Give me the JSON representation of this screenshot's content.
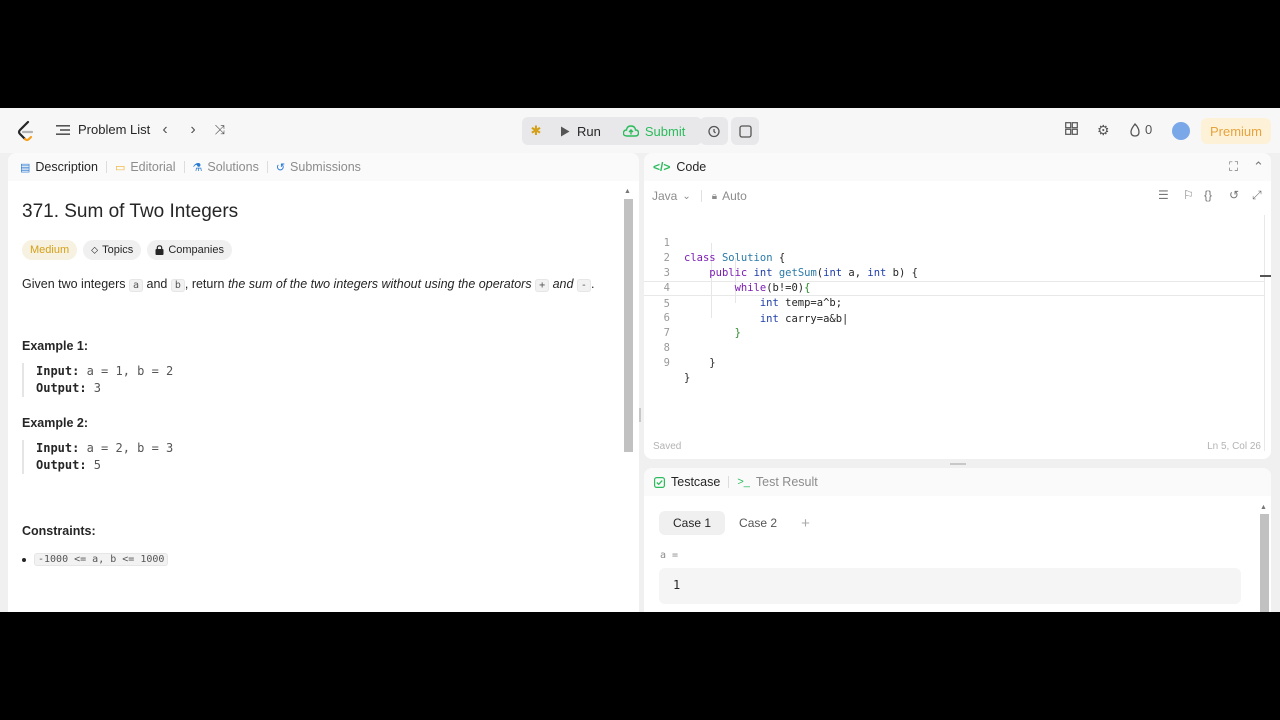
{
  "nav": {
    "problem_list": "Problem List",
    "run": "Run",
    "submit": "Submit",
    "streak": "0",
    "premium": "Premium"
  },
  "colors": {
    "accent_green": "#2cbb5d",
    "medium": "#d4a017",
    "premium": "#e6a23c"
  },
  "left": {
    "tabs": [
      "Description",
      "Editorial",
      "Solutions",
      "Submissions"
    ],
    "title": "371. Sum of Two Integers",
    "tags": [
      "Medium",
      "Topics",
      "Companies"
    ],
    "statement": {
      "p1": "Given two integers ",
      "a": "a",
      "p2": " and ",
      "b": "b",
      "p3": ", return ",
      "italic": "the sum of the two integers without using the operators ",
      "plus": "+",
      "and": " and ",
      "minus": "-",
      "end": "."
    },
    "examples": [
      {
        "title": "Example 1:",
        "input_label": "Input:",
        "input": " a = 1, b = 2",
        "output_label": "Output:",
        "output": " 3"
      },
      {
        "title": "Example 2:",
        "input_label": "Input:",
        "input": " a = 2, b = 3",
        "output_label": "Output:",
        "output": " 5"
      }
    ],
    "constraints_title": "Constraints:",
    "constraint": "-1000 <= a, b <= 1000"
  },
  "code": {
    "title": "Code",
    "language": "Java",
    "mode": "Auto",
    "saved": "Saved",
    "position": "Ln 5, Col 26",
    "line_numbers": [
      "1",
      "2",
      "3",
      "4",
      "5",
      "6",
      "7",
      "8",
      "9"
    ]
  },
  "test": {
    "tab_testcase": "Testcase",
    "tab_result": "Test Result",
    "cases": [
      "Case 1",
      "Case 2"
    ],
    "var_label": "a =",
    "var_value": "1"
  }
}
